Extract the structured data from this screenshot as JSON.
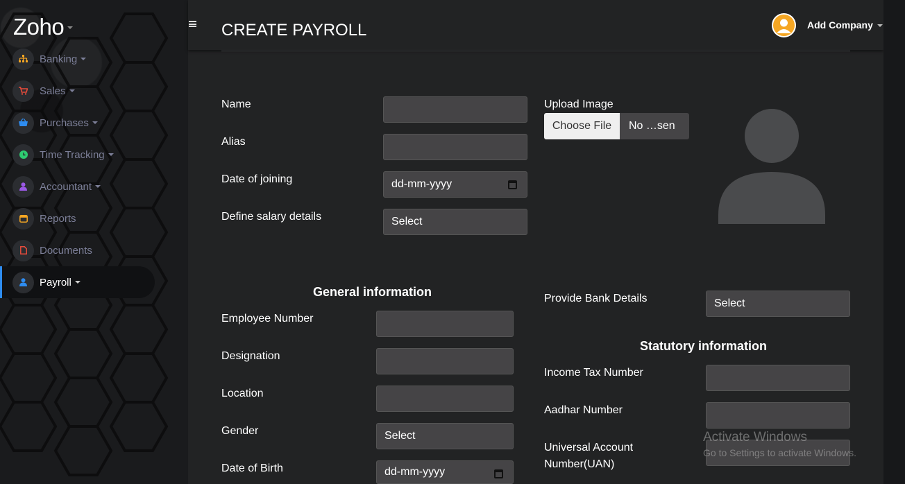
{
  "brand": "Zoho",
  "sidebar": {
    "items": [
      {
        "label": "Banking",
        "icon": "sitemap-icon",
        "color": "#f5a623",
        "caret": true
      },
      {
        "label": "Sales",
        "icon": "cart-icon",
        "color": "#e74c3c",
        "caret": true
      },
      {
        "label": "Purchases",
        "icon": "basket-icon",
        "color": "#2e8cf0",
        "caret": true
      },
      {
        "label": "Time Tracking",
        "icon": "clock-icon",
        "color": "#2ecc71",
        "caret": true
      },
      {
        "label": "Accountant",
        "icon": "user-icon",
        "color": "#9b59e6",
        "caret": true
      },
      {
        "label": "Reports",
        "icon": "calendar-icon",
        "color": "#f5a623",
        "caret": false
      },
      {
        "label": "Documents",
        "icon": "file-icon",
        "color": "#e74c3c",
        "caret": false
      },
      {
        "label": "Payroll",
        "icon": "user-icon",
        "color": "#2e8cf0",
        "caret": true,
        "active": true
      }
    ]
  },
  "header": {
    "title": "CREATE PAYROLL",
    "company_label": "Add Company"
  },
  "form": {
    "name_label": "Name",
    "alias_label": "Alias",
    "doj_label": "Date of joining",
    "doj_value": "dd-mm-yyyy",
    "salary_label": "Define salary details",
    "salary_value": "Select",
    "upload_label": "Upload Image",
    "choose_file": "Choose File",
    "file_status": "No …sen",
    "general_title": "General information",
    "emp_no_label": "Employee Number",
    "designation_label": "Designation",
    "location_label": "Location",
    "gender_label": "Gender",
    "gender_value": "Select",
    "dob_label": "Date of Birth",
    "dob_value": "dd-mm-yyyy",
    "bank_label": "Provide Bank Details",
    "bank_value": "Select",
    "statutory_title": "Statutory information",
    "income_tax_label": "Income Tax Number",
    "aadhar_label": "Aadhar Number",
    "uan_label_1": "Universal Account",
    "uan_label_2": "Number(UAN)"
  },
  "watermark": {
    "line1": "Activate Windows",
    "line2": "Go to Settings to activate Windows."
  }
}
